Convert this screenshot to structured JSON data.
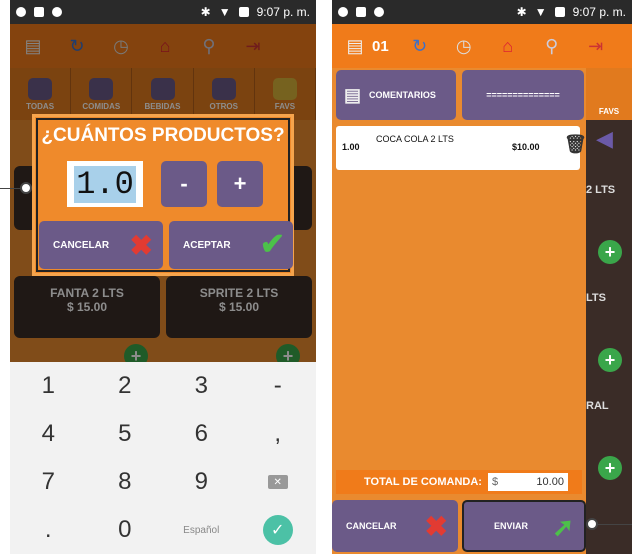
{
  "left": {
    "status": {
      "time": "9:07 p. m."
    },
    "categories": [
      "TODAS",
      "COMIDAS",
      "BEBIDAS",
      "OTROS",
      "FAVS"
    ],
    "products": [
      {
        "name": "FANTA 2 LTS",
        "price": "$ 15.00"
      },
      {
        "name": "SPRITE 2 LTS",
        "price": "$ 15.00"
      }
    ],
    "dialog": {
      "title": "¿CUÁNTOS PRODUCTOS?",
      "quantity": "1.0",
      "minus": "-",
      "plus": "+",
      "cancel": "CANCELAR",
      "accept": "ACEPTAR"
    },
    "keyboard": {
      "keys": [
        "1",
        "2",
        "3",
        "-",
        "4",
        "5",
        "6",
        ",",
        "7",
        "8",
        "9",
        "",
        "",
        "0",
        "Español",
        ""
      ]
    }
  },
  "right": {
    "status": {
      "time": "9:07 p. m."
    },
    "order_number": "01",
    "buttons": {
      "comments": "COMENTARIOS",
      "blank": "=============="
    },
    "item": {
      "qty": "1.00",
      "name": "COCA COLA 2 LTS",
      "price": "$10.00"
    },
    "side_labels": [
      "FAVS",
      "2 LTS",
      "LTS",
      "RAL"
    ],
    "total_label": "TOTAL DE COMANDA:",
    "total_currency": "$",
    "total_value": "10.00",
    "cancel": "CANCELAR",
    "send": "ENVIAR"
  },
  "colors": {
    "accent": "#f07b1a",
    "button": "#6b5a88",
    "add": "#3aa64a",
    "cancel_x": "#e23b32",
    "ok": "#4cc14a"
  }
}
